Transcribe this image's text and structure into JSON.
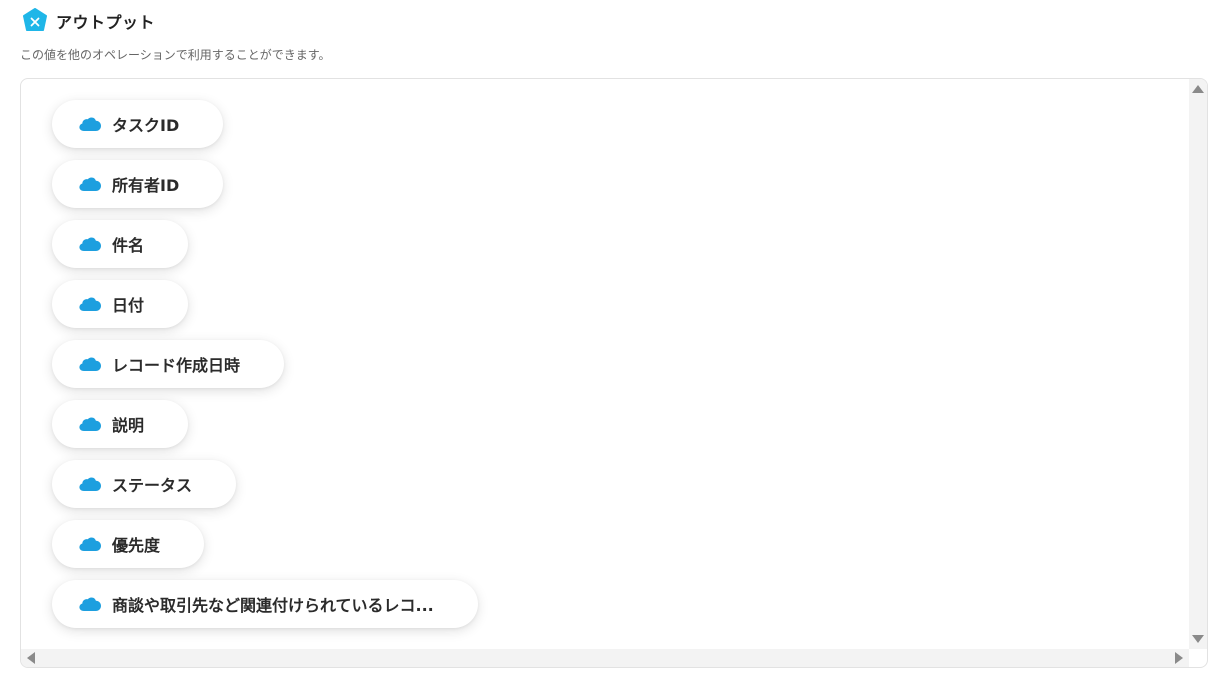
{
  "header": {
    "title": "アウトプット",
    "icon": "variable-icon",
    "icon_color": "#1fb6e8"
  },
  "subtitle": "この値を他のオペレーションで利用することができます。",
  "outputs": {
    "icon": "salesforce-cloud-icon",
    "icon_color": "#1d9fdf",
    "items": [
      {
        "label": "タスクID"
      },
      {
        "label": "所有者ID"
      },
      {
        "label": "件名"
      },
      {
        "label": "日付"
      },
      {
        "label": "レコード作成日時"
      },
      {
        "label": "説明"
      },
      {
        "label": "ステータス"
      },
      {
        "label": "優先度"
      },
      {
        "label": "商談や取引先など関連付けられているレコ..."
      }
    ]
  }
}
